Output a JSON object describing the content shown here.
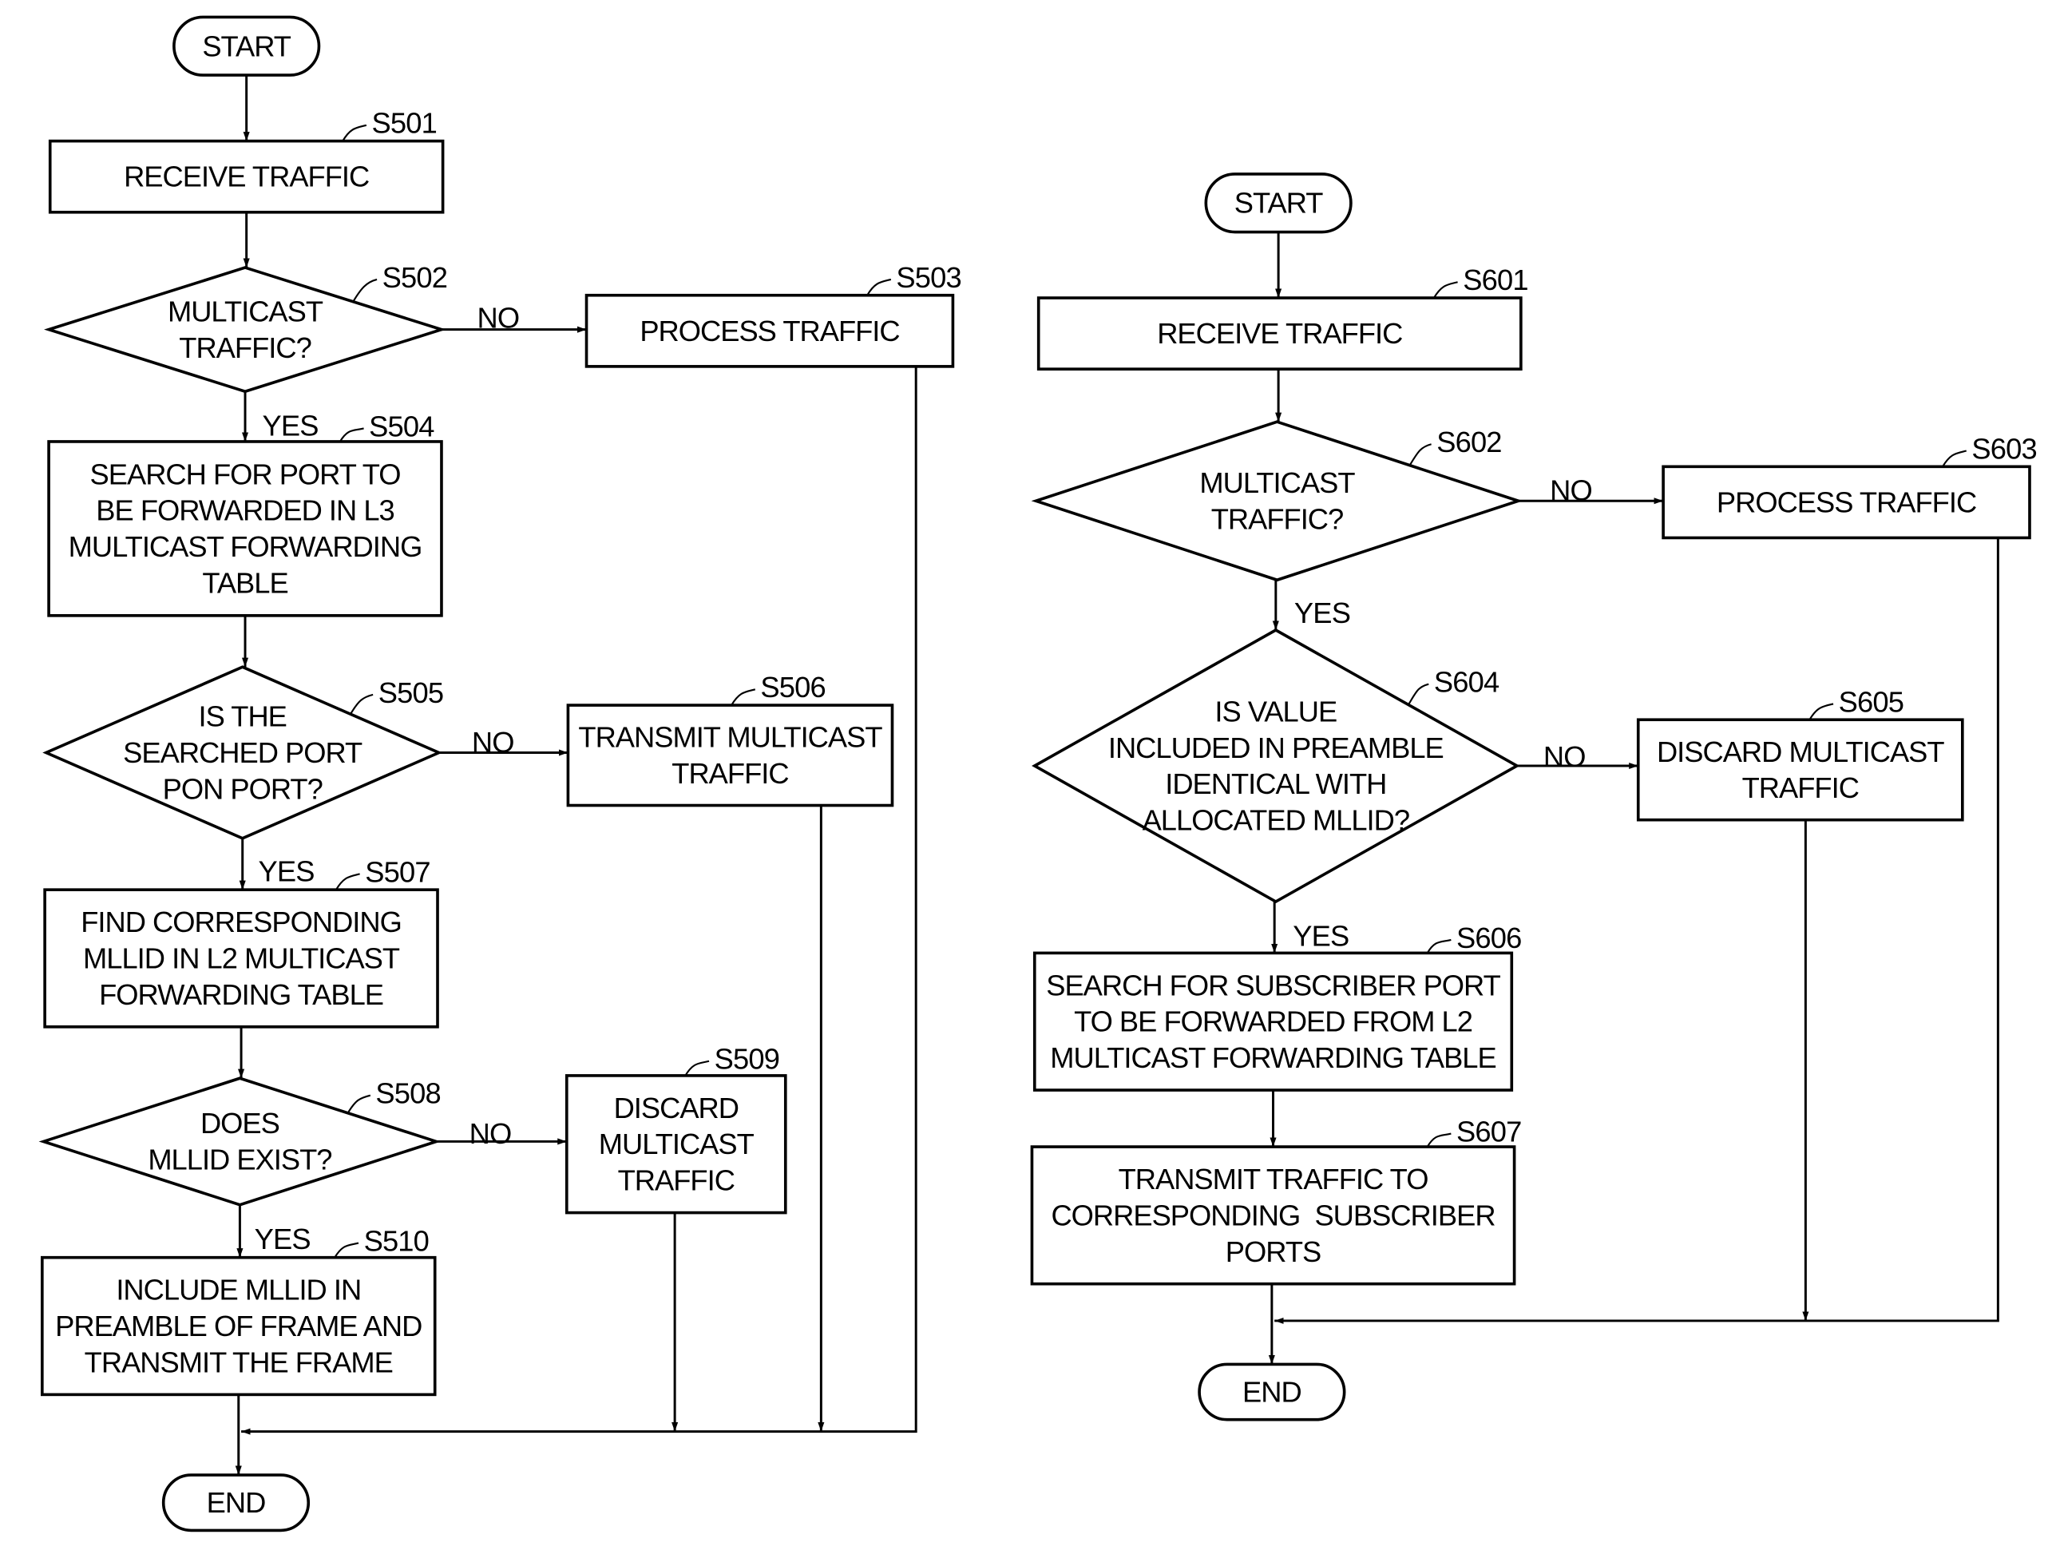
{
  "flowcharts": [
    {
      "id": "fig5",
      "nodes": [
        {
          "id": "start",
          "type": "terminal",
          "lines": [
            "START"
          ]
        },
        {
          "id": "S501",
          "type": "process",
          "step": "S501",
          "lines": [
            "RECEIVE TRAFFIC"
          ]
        },
        {
          "id": "S502",
          "type": "decision",
          "step": "S502",
          "lines": [
            "MULTICAST",
            "TRAFFIC?"
          ]
        },
        {
          "id": "S503",
          "type": "process",
          "step": "S503",
          "lines": [
            "PROCESS TRAFFIC"
          ]
        },
        {
          "id": "S504",
          "type": "process",
          "step": "S504",
          "lines": [
            "SEARCH FOR PORT TO",
            "BE FORWARDED IN L3",
            "MULTICAST FORWARDING",
            "TABLE"
          ]
        },
        {
          "id": "S505",
          "type": "decision",
          "step": "S505",
          "lines": [
            "IS THE",
            "SEARCHED PORT",
            "PON PORT?"
          ]
        },
        {
          "id": "S506",
          "type": "process",
          "step": "S506",
          "lines": [
            "TRANSMIT MULTICAST",
            "TRAFFIC"
          ]
        },
        {
          "id": "S507",
          "type": "process",
          "step": "S507",
          "lines": [
            "FIND CORRESPONDING",
            "MLLID IN L2 MULTICAST",
            "FORWARDING TABLE"
          ]
        },
        {
          "id": "S508",
          "type": "decision",
          "step": "S508",
          "lines": [
            "DOES",
            "MLLID EXIST?"
          ]
        },
        {
          "id": "S509",
          "type": "process",
          "step": "S509",
          "lines": [
            "DISCARD",
            "MULTICAST",
            "TRAFFIC"
          ]
        },
        {
          "id": "S510",
          "type": "process",
          "step": "S510",
          "lines": [
            "INCLUDE MLLID IN",
            "PREAMBLE OF FRAME AND",
            "TRANSMIT THE FRAME"
          ]
        },
        {
          "id": "end",
          "type": "terminal",
          "lines": [
            "END"
          ]
        }
      ],
      "edge_labels": {
        "S502_no": "NO",
        "S502_yes": "YES",
        "S505_no": "NO",
        "S505_yes": "YES",
        "S508_no": "NO",
        "S508_yes": "YES"
      }
    },
    {
      "id": "fig6",
      "nodes": [
        {
          "id": "start",
          "type": "terminal",
          "lines": [
            "START"
          ]
        },
        {
          "id": "S601",
          "type": "process",
          "step": "S601",
          "lines": [
            "RECEIVE TRAFFIC"
          ]
        },
        {
          "id": "S602",
          "type": "decision",
          "step": "S602",
          "lines": [
            "MULTICAST",
            "TRAFFIC?"
          ]
        },
        {
          "id": "S603",
          "type": "process",
          "step": "S603",
          "lines": [
            "PROCESS TRAFFIC"
          ]
        },
        {
          "id": "S604",
          "type": "decision",
          "step": "S604",
          "lines": [
            "IS VALUE",
            "INCLUDED IN PREAMBLE",
            "IDENTICAL WITH",
            "ALLOCATED MLLID?"
          ]
        },
        {
          "id": "S605",
          "type": "process",
          "step": "S605",
          "lines": [
            "DISCARD MULTICAST",
            "TRAFFIC"
          ]
        },
        {
          "id": "S606",
          "type": "process",
          "step": "S606",
          "lines": [
            "SEARCH FOR SUBSCRIBER PORT",
            "TO BE FORWARDED FROM L2",
            "MULTICAST FORWARDING TABLE"
          ]
        },
        {
          "id": "S607",
          "type": "process",
          "step": "S607",
          "lines": [
            "TRANSMIT TRAFFIC TO",
            "CORRESPONDING  SUBSCRIBER",
            "PORTS"
          ]
        },
        {
          "id": "end",
          "type": "terminal",
          "lines": [
            "END"
          ]
        }
      ],
      "edge_labels": {
        "S602_no": "NO",
        "S602_yes": "YES",
        "S604_no": "NO",
        "S604_yes": "YES"
      }
    }
  ]
}
